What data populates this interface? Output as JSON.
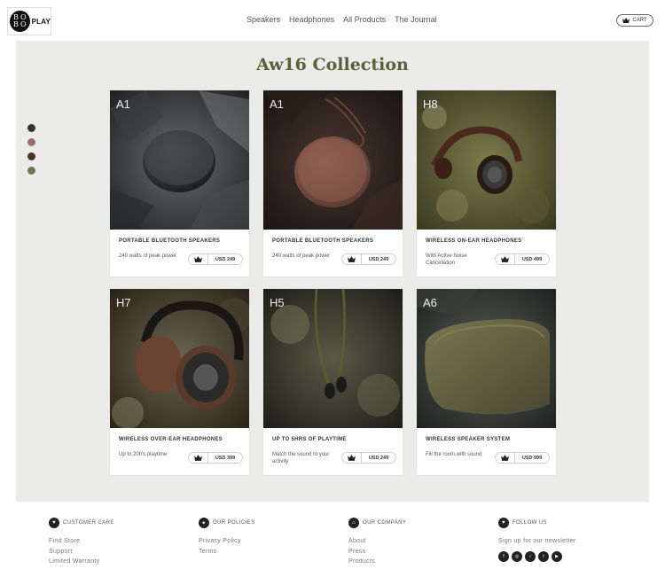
{
  "header": {
    "logo_text": "PLAY",
    "logo_mark": [
      "B",
      "O",
      "B",
      "O"
    ],
    "nav": [
      "Speakers",
      "Headphones",
      "All Products",
      "The Journal"
    ],
    "cart_label": "CART"
  },
  "main": {
    "title": "Aw16 Collection",
    "color_dots": [
      "#333333",
      "#9b6f6f",
      "#4a3428",
      "#6f7651"
    ],
    "products": [
      {
        "model": "A1",
        "title": "PORTABLE BLUETOOTH SPEAKERS",
        "desc": "240 watts of peak power",
        "price": "USD 249"
      },
      {
        "model": "A1",
        "title": "PORTABLE BLUETOOTH SPEAKERS",
        "desc": "240 watts of peak power",
        "price": "USD 249"
      },
      {
        "model": "H8",
        "title": "WIRELESS ON-EAR HEADPHONES",
        "desc": "With Active Noise Cancellation",
        "price": "USD 499"
      },
      {
        "model": "H7",
        "title": "WIRELESS OVER-EAR HEADPHONES",
        "desc": "Up to 20h's playtime",
        "price": "USD 399"
      },
      {
        "model": "H5",
        "title": "UP TO 5HRS OF PLAYTIME",
        "desc": "Match the sound to your activity",
        "price": "USD 249"
      },
      {
        "model": "A6",
        "title": "WIRELESS SPEAKER SYSTEM",
        "desc": "Fill the room with sound",
        "price": "USD 999"
      }
    ]
  },
  "footer": {
    "customer_care": {
      "heading": "CUSTOMER CARE",
      "links": [
        "Find Store",
        "Support",
        "Limited Warranty"
      ]
    },
    "policies": {
      "heading": "OUR POLICIES",
      "links": [
        "Privacy Policy",
        "Terms"
      ]
    },
    "company": {
      "heading": "OUR COMPANY",
      "links": [
        "About",
        "Press",
        "Products"
      ]
    },
    "follow": {
      "heading": "FOLLOW US",
      "newsletter": "Sign up for our newsletter",
      "social": [
        "facebook-icon",
        "instagram-icon",
        "music-icon",
        "twitter-icon",
        "youtube-icon"
      ]
    }
  }
}
